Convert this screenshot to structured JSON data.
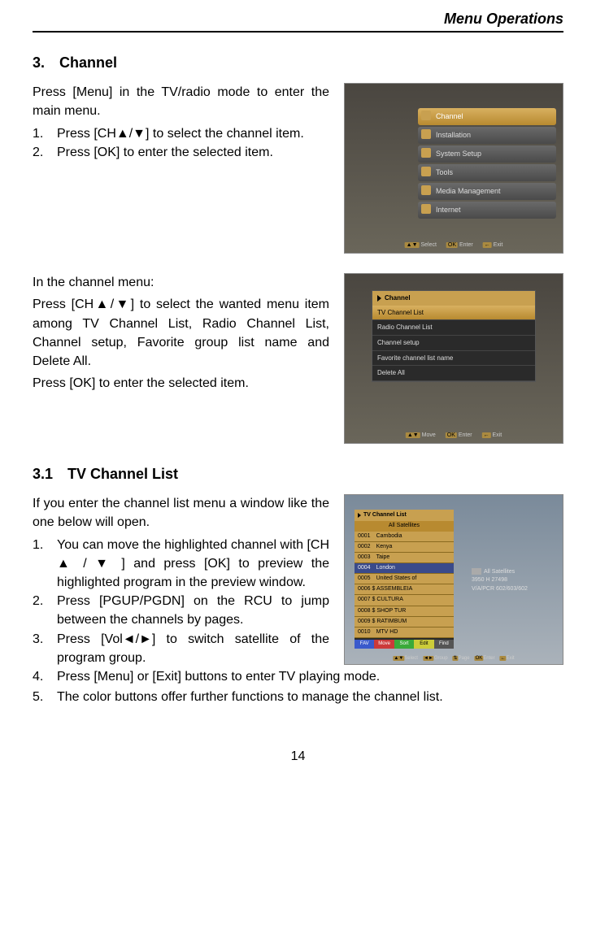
{
  "header": {
    "title": "Menu Operations"
  },
  "section1": {
    "heading": "3.　Channel",
    "intro": "Press [Menu] in the TV/radio mode to enter the main menu.",
    "items": [
      {
        "num": "1.",
        "text": "Press [CH▲/▼] to select the channel item."
      },
      {
        "num": "2.",
        "text": "Press [OK] to enter the selected item."
      }
    ],
    "shot": {
      "menu": [
        "Channel",
        "Installation",
        "System Setup",
        "Tools",
        "Media Management",
        "Internet"
      ],
      "hints": [
        {
          "key": "▲▼",
          "label": "Select"
        },
        {
          "key": "OK",
          "label": "Enter"
        },
        {
          "key": "←",
          "label": "Exit"
        }
      ]
    }
  },
  "section2": {
    "pre": "In the channel menu:",
    "para1": "Press [CH▲/▼] to select the wanted menu item among TV Channel List, Radio Channel List, Channel setup, Favorite group list name and Delete All.",
    "para2": "Press [OK] to enter the selected item.",
    "shot": {
      "title": "Channel",
      "menu": [
        "TV Channel List",
        "Radio Channel List",
        "Channel setup",
        "Favorite channel list name",
        "Delete All"
      ],
      "hints": [
        {
          "key": "▲▼",
          "label": "Move"
        },
        {
          "key": "OK",
          "label": "Enter"
        },
        {
          "key": "←",
          "label": "Exit"
        }
      ]
    }
  },
  "section3": {
    "heading": "3.1　TV  Channel  List",
    "intro": "If you enter the channel list menu a window like the one below will open.",
    "items_top": [
      {
        "num": "1.",
        "text": "You can move the highlighted channel with [CH ▲ / ▼ ] and press [OK] to preview the highlighted program in the preview window."
      },
      {
        "num": "2.",
        "text": "Press [PGUP/PGDN] on the RCU to jump between the channels by pages."
      },
      {
        "num": "3.",
        "text": "Press [Vol◄/►] to switch satellite of the program group."
      }
    ],
    "items_full": [
      {
        "num": "4.",
        "text": "Press [Menu] or [Exit] buttons to enter TV playing mode."
      },
      {
        "num": "5.",
        "text": "The color buttons offer further functions to manage the channel list."
      }
    ],
    "shot": {
      "title": "TV Channel List",
      "chip": "All Satellites",
      "channels": [
        "0001　Cambodia",
        "0002　Kenya",
        "0003　Taipe",
        "0004　London",
        "0005　United States of",
        "0006 $ ASSEMBLEIA",
        "0007 $ CULTURA",
        "0008 $ SHOP TUR",
        "0009 $ RATIMBUM",
        "0010　MTV HD"
      ],
      "highlight_index": 3,
      "info": {
        "sat": "All Satellites",
        "tp": "3950 H 27498",
        "pids": "V/A/PCR 602/603/602"
      },
      "buttons": [
        "FAV",
        "Move",
        "Sort",
        "Edit",
        "Find"
      ],
      "hints": [
        {
          "key": "▲▼",
          "label": "Select"
        },
        {
          "key": "◄►",
          "label": "Group"
        },
        {
          "key": "⇅",
          "label": "Page"
        },
        {
          "key": "OK",
          "label": "Enter"
        },
        {
          "key": "←",
          "label": "Exit"
        }
      ]
    }
  },
  "page_number": "14"
}
